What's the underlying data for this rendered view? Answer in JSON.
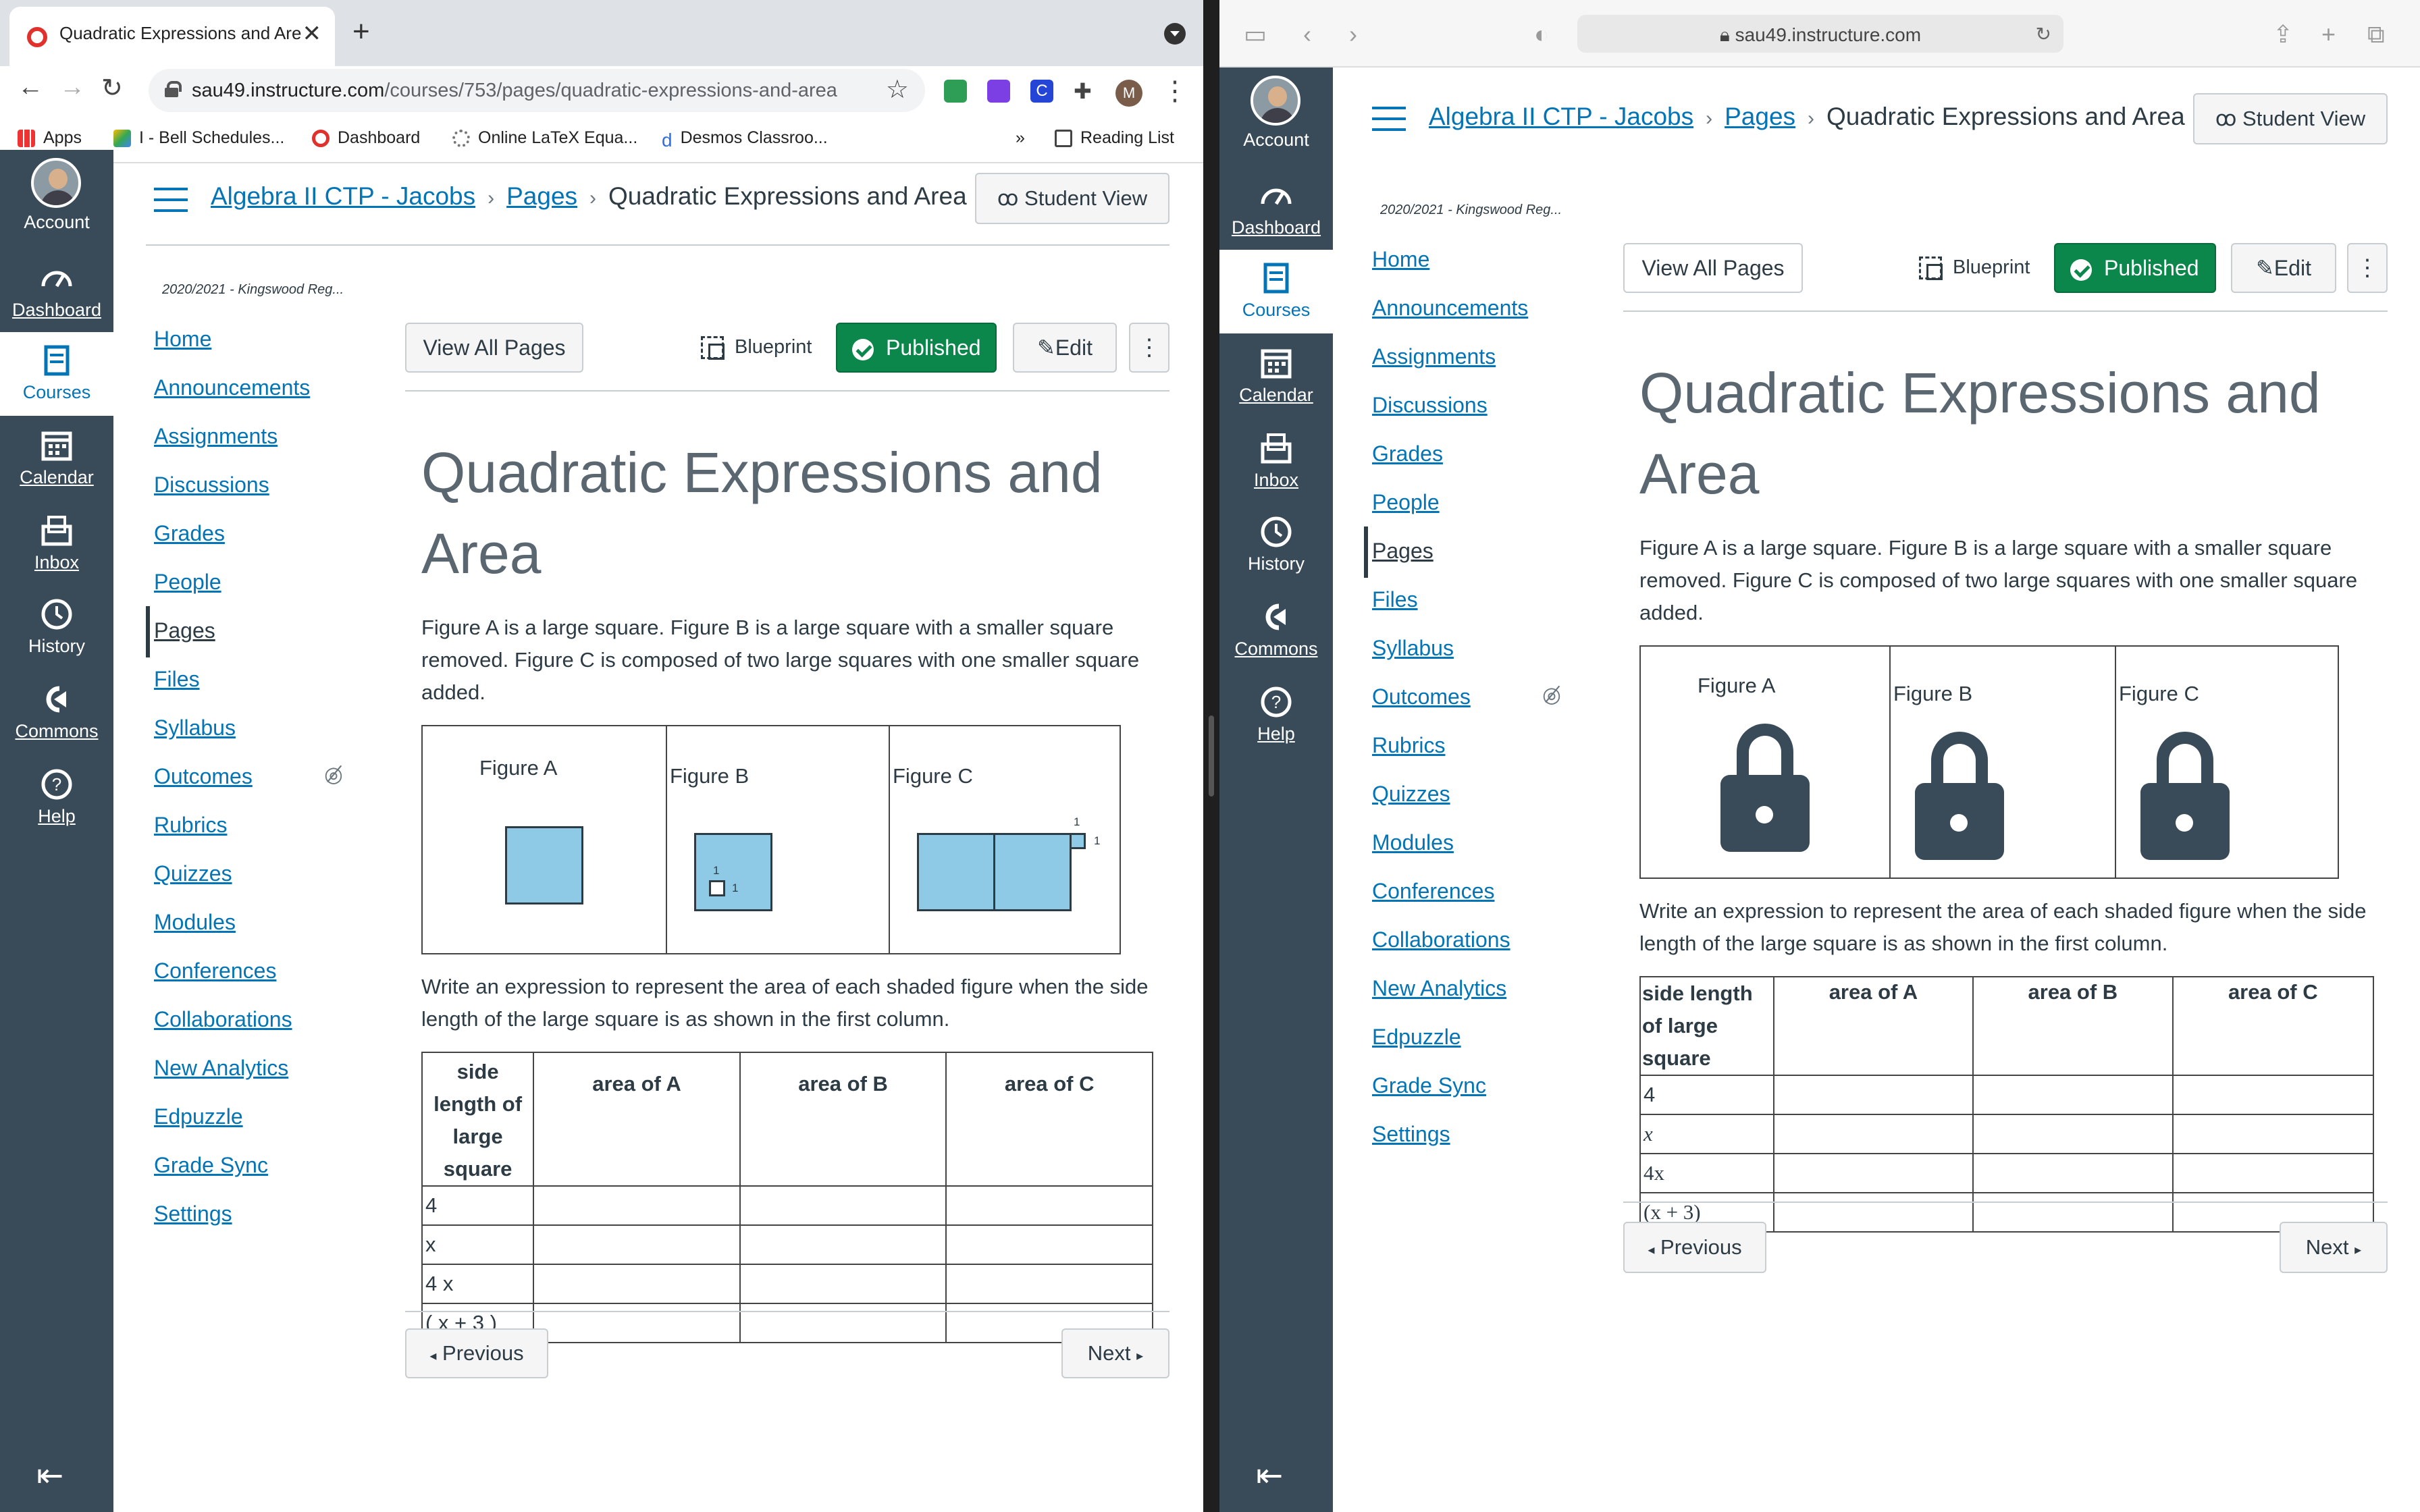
{
  "left_browser": {
    "tab_title": "Quadratic Expressions and Are",
    "url_host": "sau49.instructure.com",
    "url_path": "/courses/753/pages/quadratic-expressions-and-area",
    "bookmarks": [
      "Apps",
      "I - Bell Schedules...",
      "Dashboard",
      "Online LaTeX Equa...",
      "Desmos Classroo..."
    ],
    "bookmarks_more": "»",
    "reading_list": "Reading List",
    "profile_letter": "M"
  },
  "right_browser": {
    "url": "sau49.instructure.com"
  },
  "global_nav": {
    "account": "Account",
    "dashboard": "Dashboard",
    "courses": "Courses",
    "calendar": "Calendar",
    "inbox": "Inbox",
    "history": "History",
    "commons": "Commons",
    "help": "Help"
  },
  "breadcrumb": {
    "course": "Algebra II CTP - Jacobs",
    "pages": "Pages",
    "current": "Quadratic Expressions and Area"
  },
  "student_view": "Student View",
  "term": "2020/2021 - Kingswood Reg...",
  "course_nav": [
    "Home",
    "Announcements",
    "Assignments",
    "Discussions",
    "Grades",
    "People",
    "Pages",
    "Files",
    "Syllabus",
    "Outcomes",
    "Rubrics",
    "Quizzes",
    "Modules",
    "Conferences",
    "Collaborations",
    "New Analytics",
    "Edpuzzle",
    "Grade Sync",
    "Settings"
  ],
  "active_nav": "Pages",
  "actions": {
    "view_all": "View All Pages",
    "blueprint": "Blueprint",
    "published": "Published",
    "edit": "Edit",
    "more": "⋮"
  },
  "page": {
    "title_line1": "Quadratic Expressions and",
    "title_line2": "Area",
    "intro": "Figure A is a large square. Figure B is a large square with a smaller square removed. Figure C is composed of two large squares with one smaller square added.",
    "figures": [
      "Figure A",
      "Figure B",
      "Figure C"
    ],
    "small_side": "1",
    "prompt": "Write an expression to represent the area of each shaded figure when the side length of the large square is as shown in the first column.",
    "table_headers_left": [
      "side length of large square",
      "area of A",
      "area of B",
      "area of C"
    ],
    "table_headers_right": [
      "side length of large square",
      "area of A",
      "area of B",
      "area of C"
    ],
    "rows_left": [
      "4",
      "x",
      "4 x",
      "( x + 3 )"
    ],
    "rows_right": [
      "4",
      "x",
      "4x",
      "(x + 3)"
    ]
  },
  "pager": {
    "previous": "Previous",
    "next": "Next"
  },
  "colors": {
    "nav_bg": "#394b58",
    "link": "#0374b5",
    "published": "#0b874b",
    "square_fill": "#8ecae6"
  }
}
